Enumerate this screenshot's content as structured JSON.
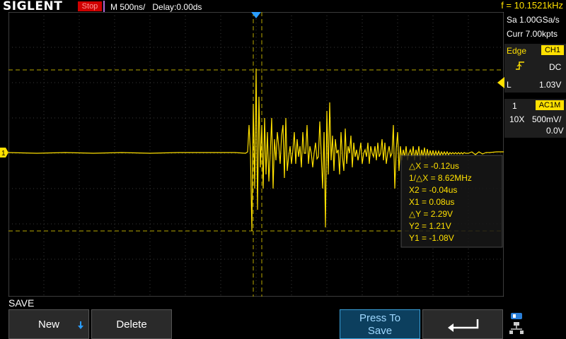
{
  "header": {
    "brand": "SIGLENT",
    "run_state": "Stop",
    "timebase": "M 500ns/",
    "delay": "Delay:0.00ds",
    "frequency": "f = 10.1521kHz"
  },
  "acquisition": {
    "sample_rate": "Sa 1.00GSa/s",
    "memory": "Curr 7.00kpts"
  },
  "trigger": {
    "type": "Edge",
    "source": "CH1",
    "coupling": "DC",
    "level_label": "L",
    "level": "1.03V"
  },
  "channel": {
    "number": "1",
    "coupling": "AC1M",
    "probe": "10X",
    "scale": "500mV/",
    "offset": "0.0V"
  },
  "cursors": {
    "dx": "△X = -0.12us",
    "inv_dx": "1/△X = 8.62MHz",
    "x2": "X2 = -0.04us",
    "x1": "X1 = 0.08us",
    "dy": "△Y = 2.29V",
    "y2": "Y2 = 1.21V",
    "y1": "Y1 = -1.08V"
  },
  "trace_marker": "1",
  "menu": {
    "title": "SAVE",
    "new_label": "New",
    "delete_label": "Delete",
    "press_to_save_line1": "Press To",
    "press_to_save_line2": "Save",
    "back_icon": "return-arrow-icon",
    "status_icon": "network-usb-icon"
  },
  "colors": {
    "trace": "#ffe000",
    "accent": "#3aa0d8",
    "stop": "#d00000"
  }
}
